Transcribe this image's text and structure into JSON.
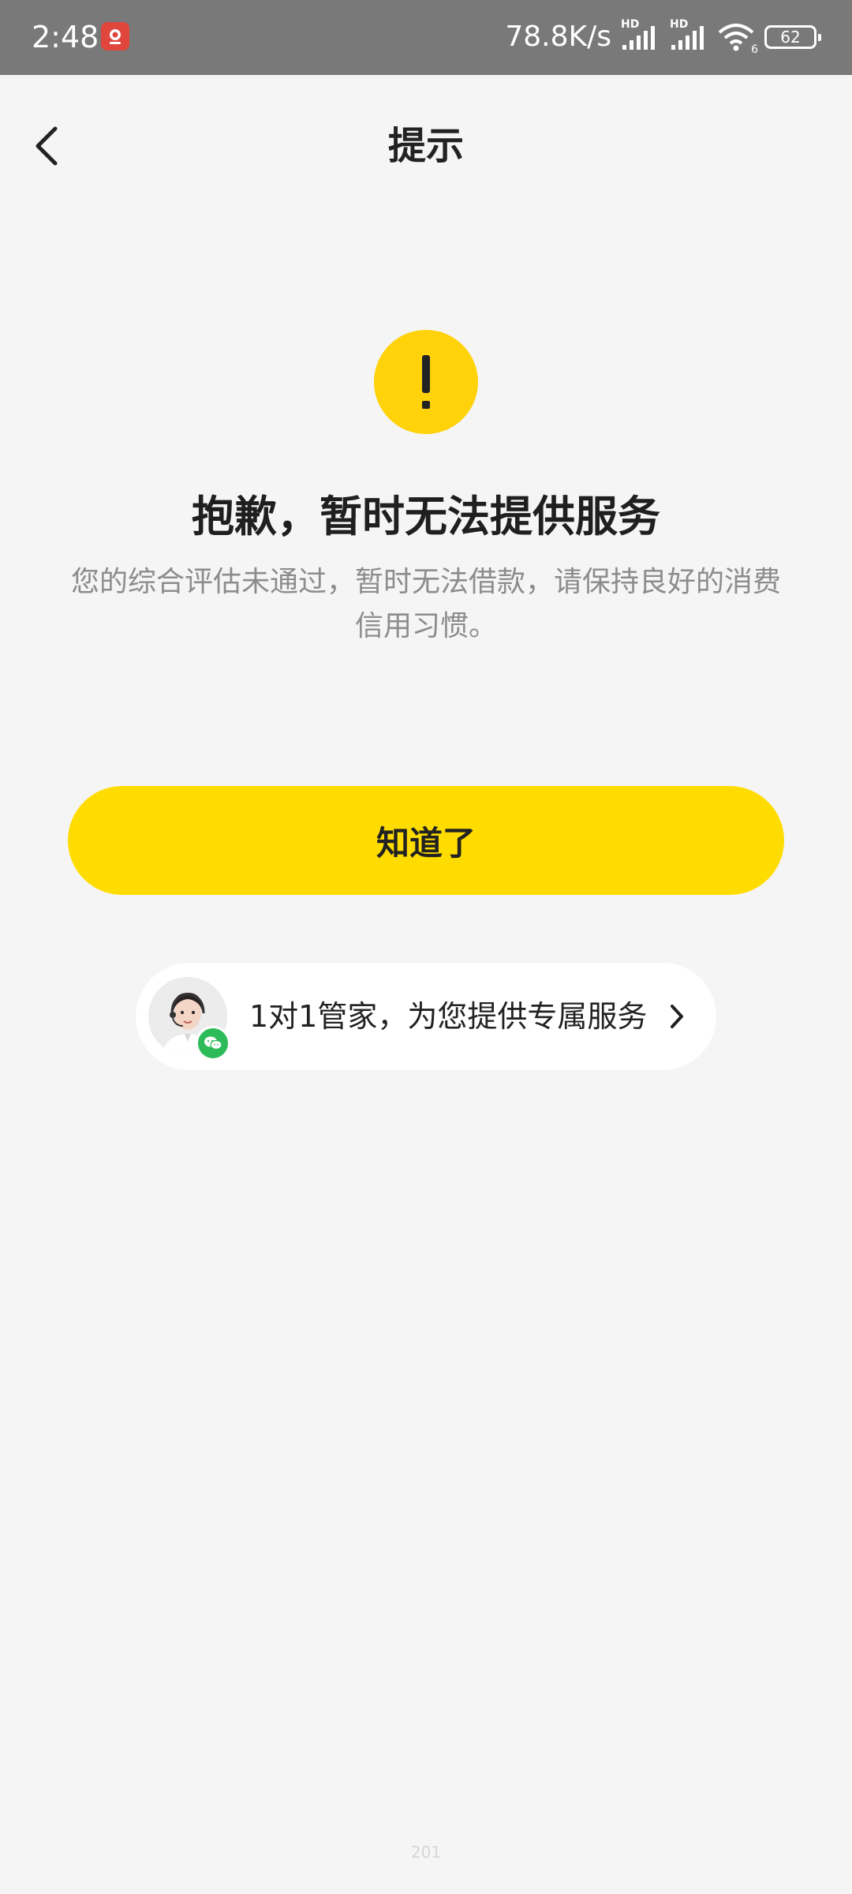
{
  "status_bar": {
    "time": "2:48",
    "network_speed": "78.8K/s",
    "network_type_1": "HD",
    "network_type_2": "HD",
    "wifi_sub": "6",
    "battery_level": "62",
    "icons": [
      "app-icon",
      "signal-icon",
      "signal-icon",
      "wifi-icon",
      "battery-icon"
    ]
  },
  "header": {
    "title": "提示",
    "back_icon": "back-arrow-icon"
  },
  "main": {
    "alert_icon": "exclamation-icon",
    "headline": "抱歉，暂时无法提供服务",
    "description": "您的综合评估未通过，暂时无法借款，请保持良好的消费信用习惯。",
    "ok_button": "知道了"
  },
  "butler": {
    "label": "1对1管家，为您提供专属服务",
    "avatar_icon": "customer-service-avatar",
    "badge_icon": "wechat-icon",
    "chevron_icon": "chevron-right-icon"
  },
  "footer": {
    "code": "201"
  },
  "colors": {
    "accent": "#ffdc00",
    "alert_icon": "#ffd20a",
    "wechat_green": "#2dbb5a",
    "background": "#f5f5f5",
    "status_bar": "#797979"
  }
}
